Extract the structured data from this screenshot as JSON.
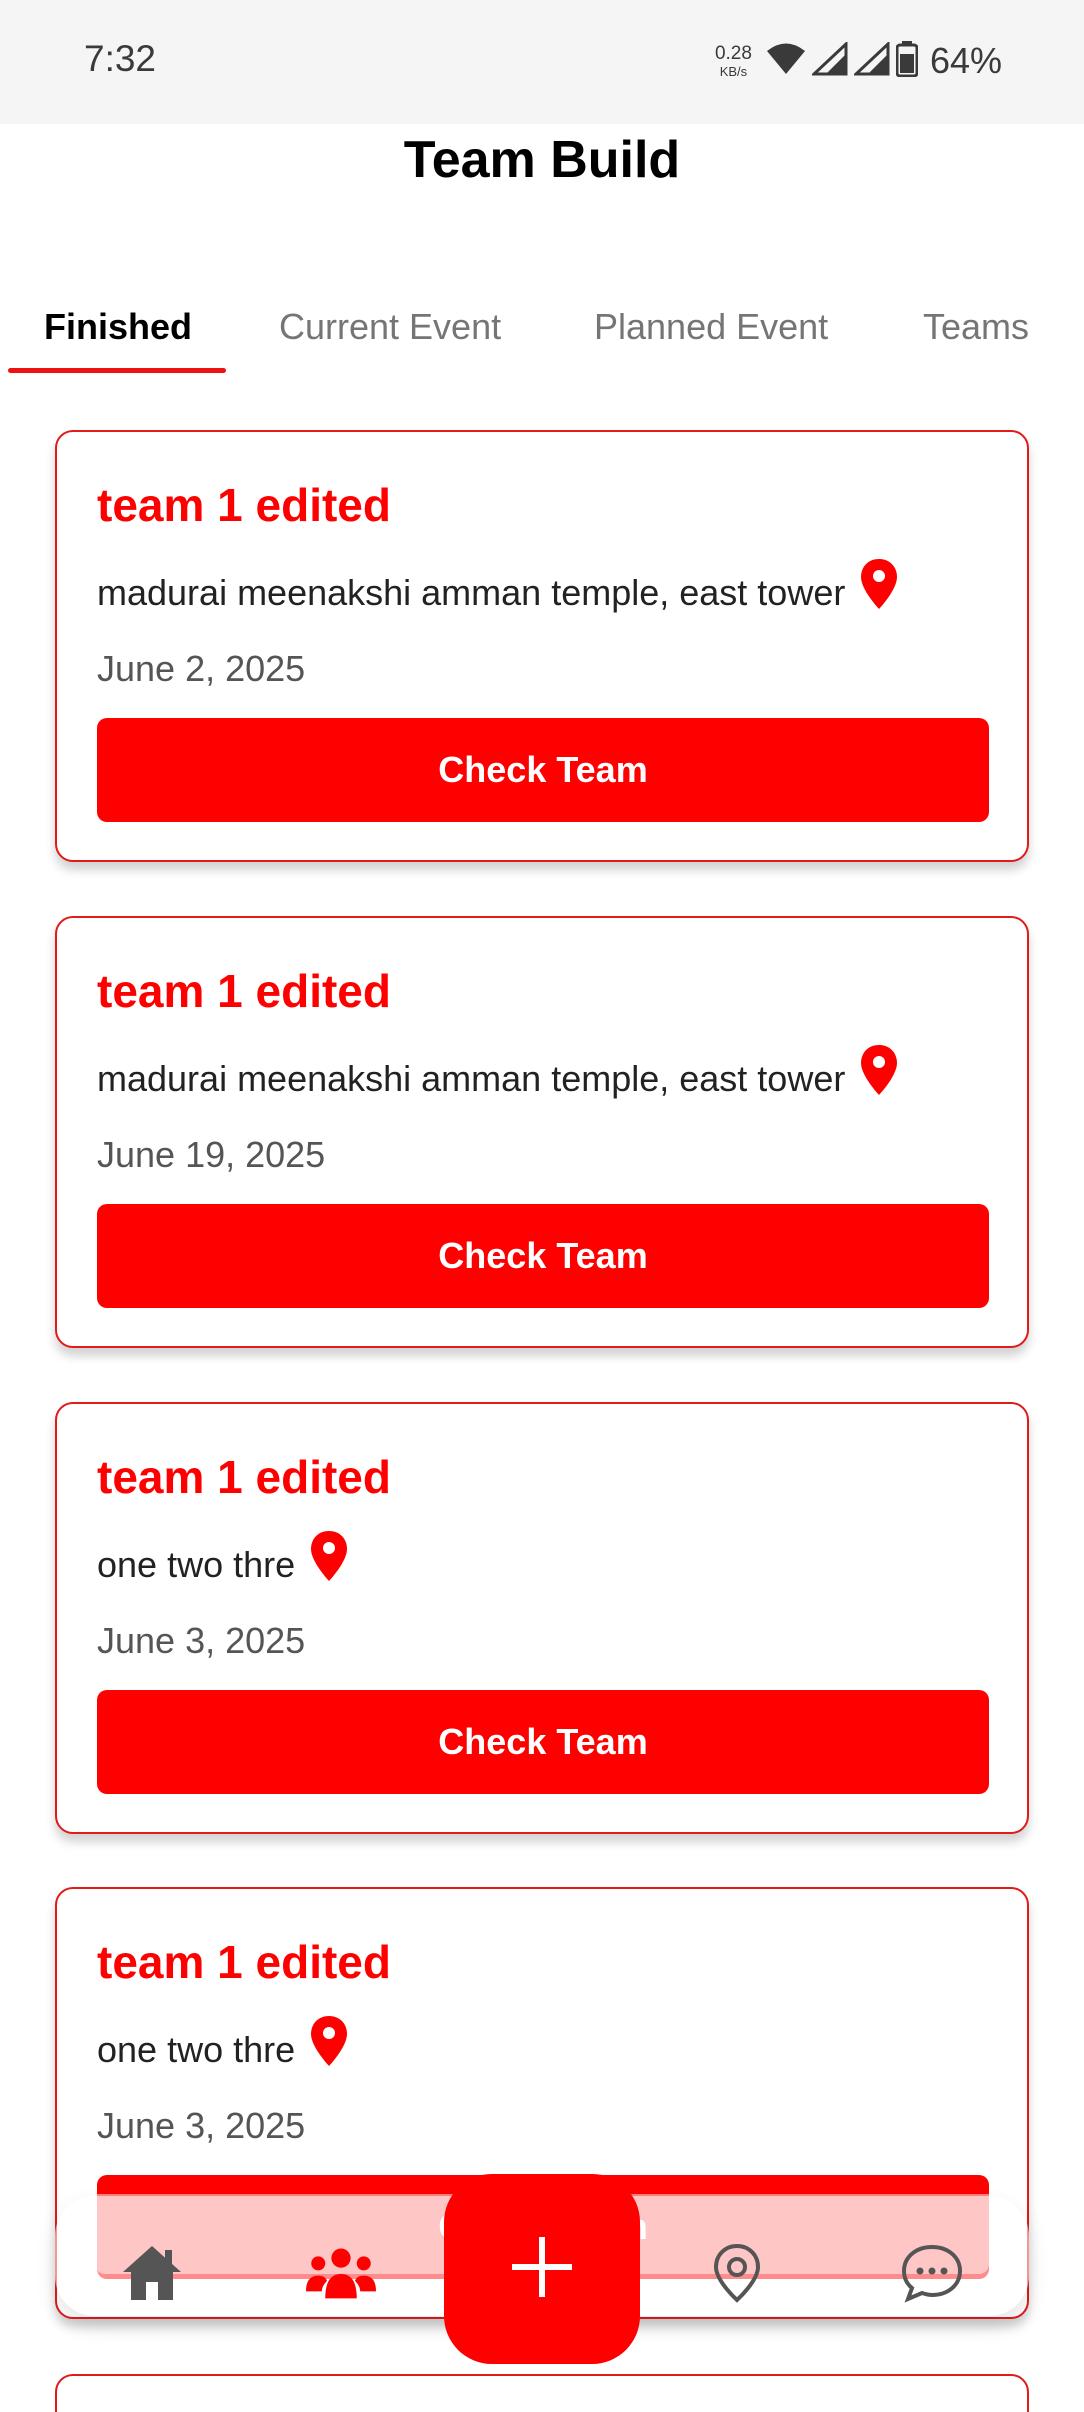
{
  "status_bar": {
    "time": "7:32",
    "net_speed_value": "0.28",
    "net_speed_unit": "KB/s",
    "battery": "64%",
    "icons": [
      "wifi-icon",
      "signal-icon",
      "signal-icon",
      "battery-icon"
    ]
  },
  "header": {
    "title": "Team Build"
  },
  "tabs": [
    {
      "label": "Finished",
      "active": true
    },
    {
      "label": "Current Event",
      "active": false
    },
    {
      "label": "Planned Event",
      "active": false
    },
    {
      "label": "Teams",
      "active": false
    }
  ],
  "cards": [
    {
      "title": "team 1 edited",
      "location": "madurai meenakshi amman temple, east tower",
      "date": "June 2, 2025",
      "button": "Check Team"
    },
    {
      "title": "team 1 edited",
      "location": "madurai meenakshi amman temple, east tower",
      "date": "June 19, 2025",
      "button": "Check Team"
    },
    {
      "title": "team 1 edited",
      "location": "one two thre",
      "date": "June 3, 2025",
      "button": "Check Team"
    },
    {
      "title": "team 1 edited",
      "location": "one two thre",
      "date": "June 3, 2025",
      "button": "Check Team"
    }
  ],
  "bottom_nav": {
    "items": [
      "home-icon",
      "team-icon",
      "add-icon",
      "location-icon",
      "chat-icon"
    ],
    "active": "team-icon",
    "accent_color": "#ff0000",
    "inactive_color": "#555555"
  }
}
